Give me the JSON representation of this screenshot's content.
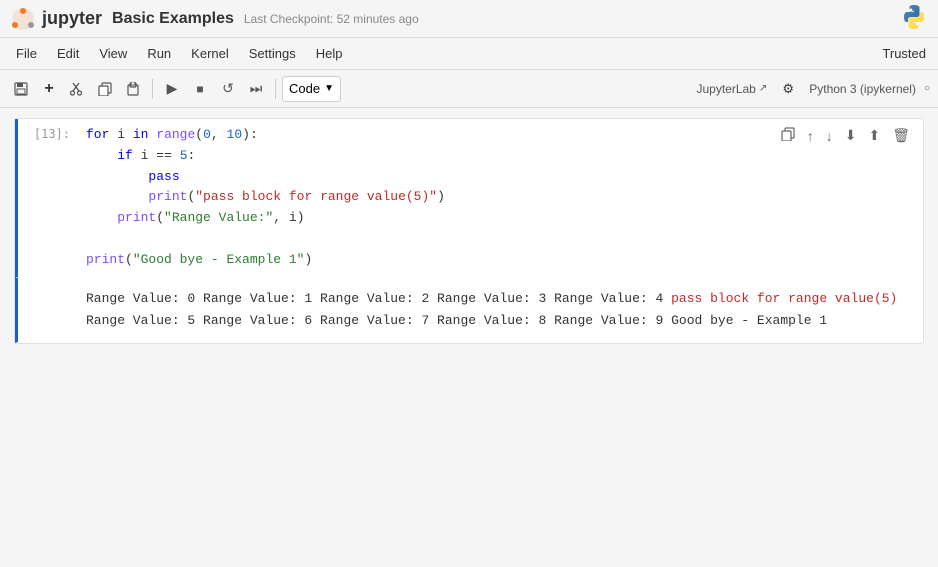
{
  "titlebar": {
    "logo_alt": "Jupyter",
    "notebook_title": "Basic Examples",
    "checkpoint_text": "Last Checkpoint: 52 minutes ago",
    "python_icon": "🐍"
  },
  "menubar": {
    "items": [
      "File",
      "Edit",
      "View",
      "Run",
      "Kernel",
      "Settings",
      "Help"
    ],
    "trusted_label": "Trusted"
  },
  "toolbar": {
    "buttons": [
      {
        "name": "save",
        "icon": "💾"
      },
      {
        "name": "add-cell",
        "icon": "+"
      },
      {
        "name": "cut",
        "icon": "✂"
      },
      {
        "name": "copy",
        "icon": "⧉"
      },
      {
        "name": "paste",
        "icon": "📋"
      },
      {
        "name": "run",
        "icon": "▶"
      },
      {
        "name": "stop",
        "icon": "■"
      },
      {
        "name": "restart",
        "icon": "↺"
      },
      {
        "name": "restart-run-all",
        "icon": "⏩"
      }
    ],
    "cell_type": "Code",
    "jupyterlab_label": "JupyterLab",
    "settings_icon": "⚙",
    "kernel_label": "Python 3 (ipykernel)",
    "kernel_status": "○"
  },
  "cell": {
    "execution_count": "[13]:",
    "code_lines": [
      "for i in range(0, 10):",
      "    if i == 5:",
      "        pass",
      "        print(\"pass block for range value(5)\")",
      "    print(\"Range Value:\", i)",
      "",
      "print(\"Good bye - Example 1\")"
    ],
    "actions": [
      "copy",
      "move-up",
      "move-down",
      "merge",
      "split",
      "delete"
    ]
  },
  "output": {
    "lines": [
      "Range Value: 0",
      "Range Value: 1",
      "Range Value: 2",
      "Range Value: 3",
      "Range Value: 4",
      "pass block for range value(5)",
      "Range Value: 5",
      "Range Value: 6",
      "Range Value: 7",
      "Range Value: 8",
      "Range Value: 9",
      "Good bye - Example 1"
    ]
  }
}
